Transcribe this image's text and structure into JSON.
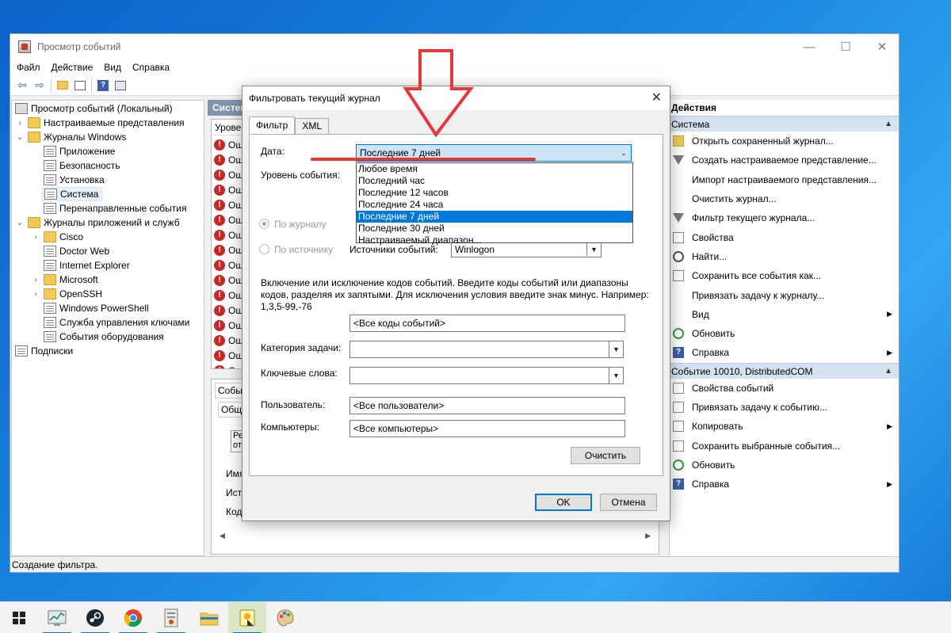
{
  "window": {
    "title": "Просмотр событий",
    "minimize": "—",
    "maximize": "☐",
    "close": "✕"
  },
  "menu": [
    "Файл",
    "Действие",
    "Вид",
    "Справка"
  ],
  "tree": {
    "root": "Просмотр событий (Локальный)",
    "custom_views": "Настраиваемые представления",
    "windows_logs": "Журналы Windows",
    "logs": [
      "Приложение",
      "Безопасность",
      "Установка",
      "Система",
      "Перенаправленные события"
    ],
    "app_logs": "Журналы приложений и служб",
    "app_children": [
      "Cisco",
      "Doctor Web",
      "Internet Explorer",
      "Microsoft",
      "OpenSSH",
      "Windows PowerShell",
      "Служба управления ключами",
      "События оборудования"
    ],
    "subscriptions": "Подписки"
  },
  "center": {
    "header": "Систем",
    "list_header": "Урове",
    "row_text": "Оши",
    "detail_tab": "Собы",
    "detail_sub": "Общ",
    "detail_fields": [
      "Имя",
      "Ист",
      "Код"
    ],
    "detail_cell": "Рег",
    "detail_cell2": "отс"
  },
  "actions": {
    "title": "Действия",
    "section1": "Система",
    "items1": [
      {
        "label": "Открыть сохраненный журнал...",
        "icon": "folder-icon",
        "arrow": false
      },
      {
        "label": "Создать настраиваемое представление...",
        "icon": "filter-icon",
        "arrow": false
      },
      {
        "label": "Импорт настраиваемого представления...",
        "icon": "none",
        "arrow": false
      },
      {
        "label": "Очистить журнал...",
        "icon": "none",
        "arrow": false
      },
      {
        "label": "Фильтр текущего журнала...",
        "icon": "filter-icon",
        "arrow": false
      },
      {
        "label": "Свойства",
        "icon": "doc-icon",
        "arrow": false
      },
      {
        "label": "Найти...",
        "icon": "search-icon",
        "arrow": false
      },
      {
        "label": "Сохранить все события как...",
        "icon": "doc-icon",
        "arrow": false
      },
      {
        "label": "Привязать задачу к журналу...",
        "icon": "none",
        "arrow": false
      },
      {
        "label": "Вид",
        "icon": "none",
        "arrow": true
      },
      {
        "label": "Обновить",
        "icon": "refresh-icon",
        "arrow": false
      },
      {
        "label": "Справка",
        "icon": "help-icon",
        "arrow": true
      }
    ],
    "section2": "Событие 10010, DistributedCOM",
    "items2": [
      {
        "label": "Свойства событий",
        "icon": "doc-icon",
        "arrow": false
      },
      {
        "label": "Привязать задачу к событию...",
        "icon": "doc-icon",
        "arrow": false
      },
      {
        "label": "Копировать",
        "icon": "doc-icon",
        "arrow": true
      },
      {
        "label": "Сохранить выбранные события...",
        "icon": "doc-icon",
        "arrow": false
      },
      {
        "label": "Обновить",
        "icon": "refresh-icon",
        "arrow": false
      },
      {
        "label": "Справка",
        "icon": "help-icon",
        "arrow": true
      }
    ]
  },
  "status": "Создание фильтра.",
  "dialog": {
    "title": "Фильтровать текущий журнал",
    "tabs": [
      "Фильтр",
      "XML"
    ],
    "date_label": "Дата:",
    "date_value": "Последние 7 дней",
    "date_options": [
      "Любое время",
      "Последний час",
      "Последние 12 часов",
      "Последние 24 часа",
      "Последние 7 дней",
      "Последние 30 дней",
      "Настраиваемый диапазон..."
    ],
    "date_selected_index": 4,
    "level_label": "Уровень события:",
    "by_log": "По журналу",
    "by_source": "По источнику",
    "sources_label": "Источники событий:",
    "sources_value": "Winlogon",
    "description": "Включение или исключение кодов событий. Введите коды событий или диапазоны кодов, разделяя их запятыми. Для исключения условия введите знак минус. Например: 1,3,5-99,-76",
    "event_codes": "<Все коды событий>",
    "task_category_label": "Категория задачи:",
    "keywords_label": "Ключевые слова:",
    "user_label": "Пользователь:",
    "user_value": "<Все пользователи>",
    "computers_label": "Компьютеры:",
    "computers_value": "<Все компьютеры>",
    "clear_button": "Очистить",
    "ok_button": "OK",
    "cancel_button": "Отмена"
  },
  "colors": {
    "annotation": "#e53935",
    "selection": "#0078d7",
    "error": "#c62828"
  },
  "taskbar": [
    "windows-start-icon",
    "resource-monitor-icon",
    "steam-icon",
    "chrome-icon",
    "event-viewer-icon",
    "file-explorer-icon",
    "paint-app-icon",
    "palette-icon"
  ]
}
